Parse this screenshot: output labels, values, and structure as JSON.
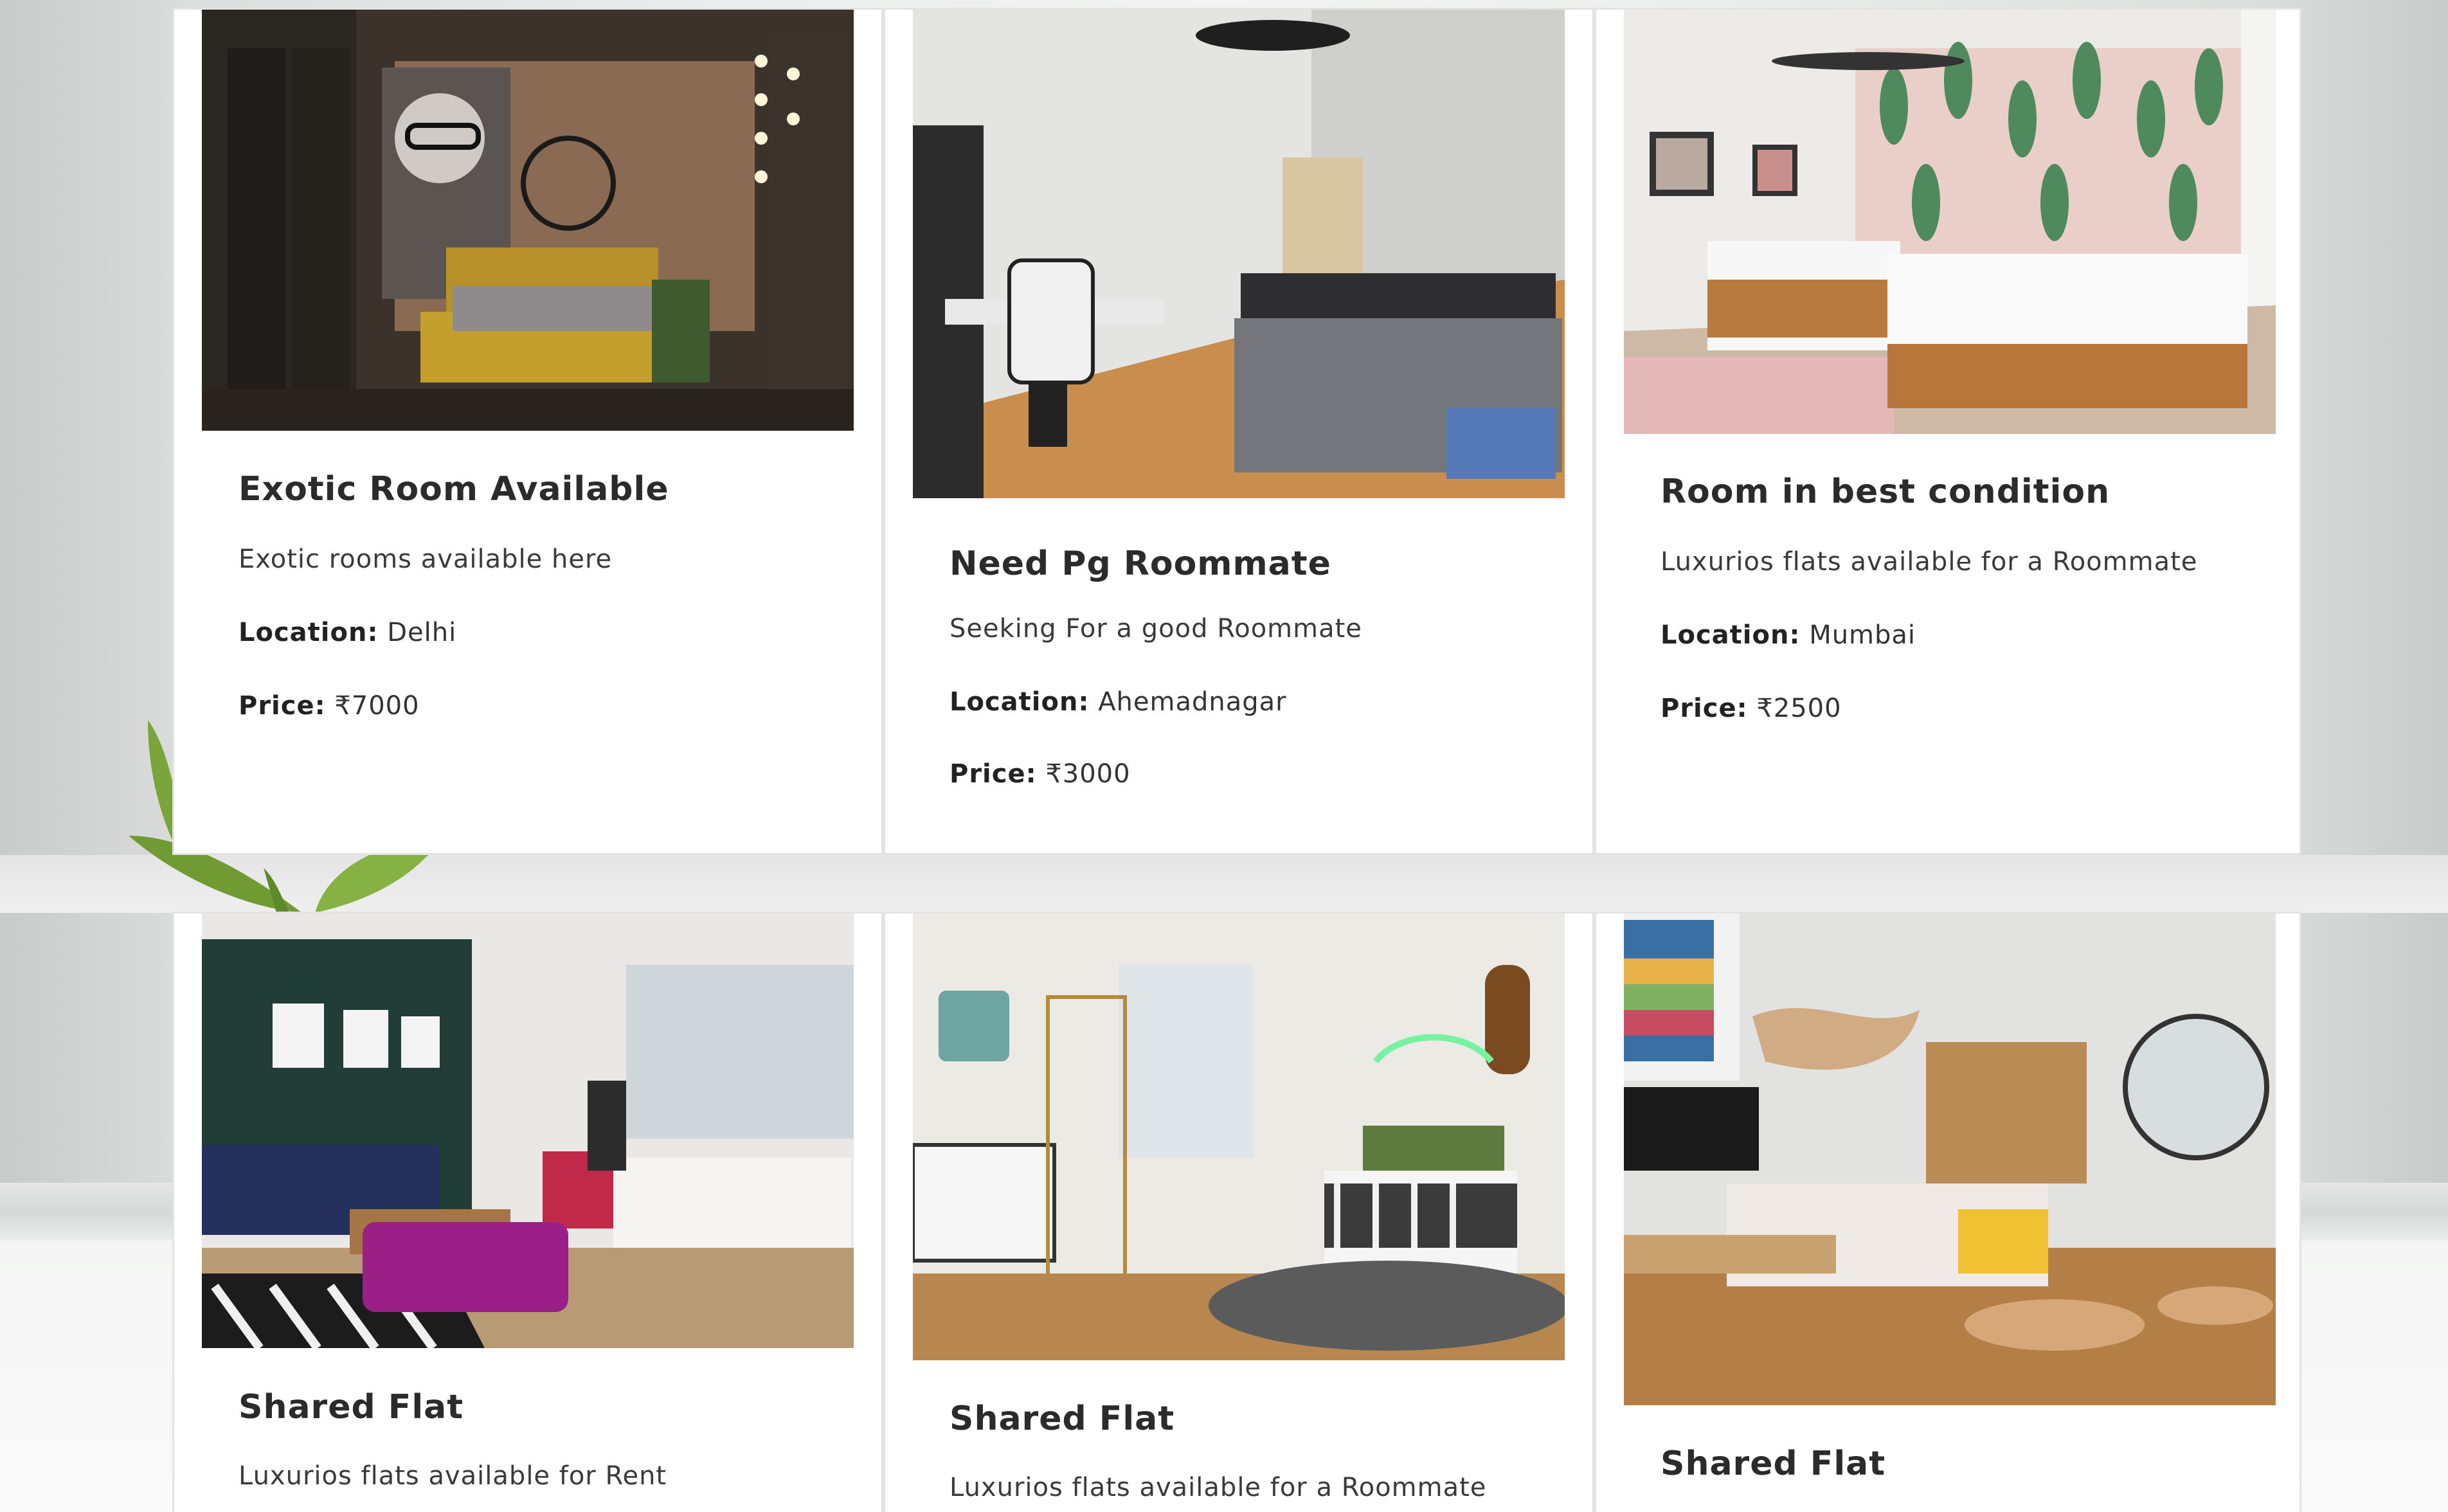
{
  "colors": {
    "card_bg": "#ffffff",
    "card_border": "#e3e3e3",
    "title": "#2b2b2b",
    "text": "#3a3a3a"
  },
  "listings": [
    {
      "title": "Exotic Room Available",
      "description": "Exotic rooms available here",
      "location_label": "Location:",
      "location": "Delhi",
      "price_label": "Price:",
      "price": "₹7000",
      "image": "exotic-bedroom-photo"
    },
    {
      "title": "Need Pg Roommate",
      "description": "Seeking For a good Roommate",
      "location_label": "Location:",
      "location": "Ahemadnagar",
      "price_label": "Price:",
      "price": "₹3000",
      "image": "pg-bedroom-photo"
    },
    {
      "title": "Room in best condition",
      "description": "Luxurios flats available for a Roommate",
      "location_label": "Location:",
      "location": "Mumbai",
      "price_label": "Price:",
      "price": "₹2500",
      "image": "twin-bedroom-photo"
    },
    {
      "title": "Shared Flat",
      "description": "Luxurios flats available for Rent",
      "image": "living-room-photo"
    },
    {
      "title": "Shared Flat",
      "description": "Luxurios flats available for a Roommate",
      "image": "studio-bedroom-photo"
    },
    {
      "title": "Shared Flat",
      "description": "",
      "image": "studio-apartment-photo"
    }
  ]
}
